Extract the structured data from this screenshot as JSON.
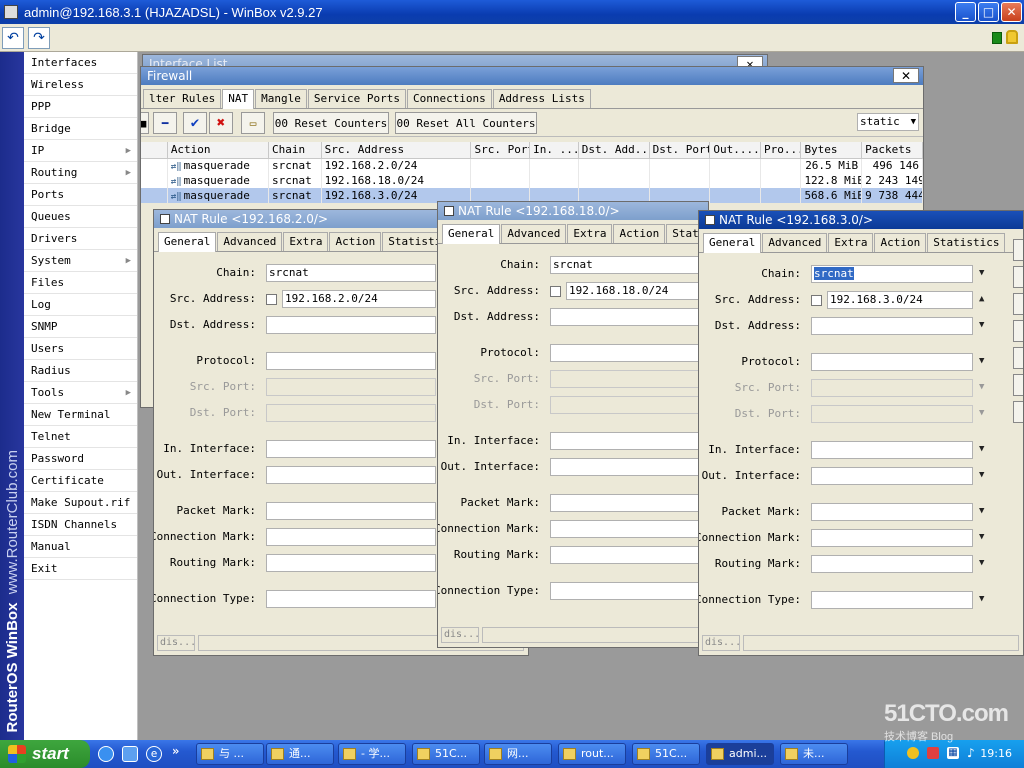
{
  "main_window": {
    "title": "admin@192.168.3.1 (HJAZADSL) - WinBox v2.9.27",
    "brand_text": "RouterOS WinBox",
    "brand_url": "www.RouterClub.com"
  },
  "left_menu": {
    "items": [
      {
        "label": "Interfaces",
        "has_submenu": false
      },
      {
        "label": "Wireless",
        "has_submenu": false
      },
      {
        "label": "PPP",
        "has_submenu": false
      },
      {
        "label": "Bridge",
        "has_submenu": false
      },
      {
        "label": "IP",
        "has_submenu": true
      },
      {
        "label": "Routing",
        "has_submenu": true
      },
      {
        "label": "Ports",
        "has_submenu": false
      },
      {
        "label": "Queues",
        "has_submenu": false
      },
      {
        "label": "Drivers",
        "has_submenu": false
      },
      {
        "label": "System",
        "has_submenu": true
      },
      {
        "label": "Files",
        "has_submenu": false
      },
      {
        "label": "Log",
        "has_submenu": false
      },
      {
        "label": "SNMP",
        "has_submenu": false
      },
      {
        "label": "Users",
        "has_submenu": false
      },
      {
        "label": "Radius",
        "has_submenu": false
      },
      {
        "label": "Tools",
        "has_submenu": true
      },
      {
        "label": "New Terminal",
        "has_submenu": false
      },
      {
        "label": "Telnet",
        "has_submenu": false
      },
      {
        "label": "Password",
        "has_submenu": false
      },
      {
        "label": "Certificate",
        "has_submenu": false
      },
      {
        "label": "Make Supout.rif",
        "has_submenu": false
      },
      {
        "label": "ISDN Channels",
        "has_submenu": false
      },
      {
        "label": "Manual",
        "has_submenu": false
      },
      {
        "label": "Exit",
        "has_submenu": false
      }
    ]
  },
  "interface_list": {
    "title": "Interface List"
  },
  "firewall": {
    "title": "Firewall",
    "tabs": [
      "lter Rules",
      "NAT",
      "Mangle",
      "Service Ports",
      "Connections",
      "Address Lists"
    ],
    "active_tab": 1,
    "reset_counters": "00 Reset Counters",
    "reset_all_counters": "00 Reset All Counters",
    "filter_value": "static",
    "columns": [
      "Action",
      "Chain",
      "Src. Address",
      "Src. Port",
      "In. ...",
      "Dst. Add...",
      "Dst. Port",
      "Out....",
      "Pro...",
      "Bytes",
      "Packets"
    ],
    "rows": [
      {
        "action": "masquerade",
        "chain": "srcnat",
        "src": "192.168.2.0/24",
        "bytes": "26.5 MiB",
        "packets": "496 146",
        "selected": false
      },
      {
        "action": "masquerade",
        "chain": "srcnat",
        "src": "192.168.18.0/24",
        "bytes": "122.8 MiB",
        "packets": "2 243 149",
        "selected": false
      },
      {
        "action": "masquerade",
        "chain": "srcnat",
        "src": "192.168.3.0/24",
        "bytes": "568.6 MiB",
        "packets": "9 738 444",
        "selected": true
      }
    ]
  },
  "nat_labels": {
    "tabs": [
      "General",
      "Advanced",
      "Extra",
      "Action",
      "Statistics"
    ],
    "chain": "Chain:",
    "src_address": "Src. Address:",
    "dst_address": "Dst. Address:",
    "protocol": "Protocol:",
    "src_port": "Src. Port:",
    "dst_port": "Dst. Port:",
    "in_interface": "In. Interface:",
    "out_interface": "Out. Interface:",
    "packet_mark": "Packet Mark:",
    "connection_mark": "Connection Mark:",
    "routing_mark": "Routing Mark:",
    "connection_type": "Connection Type:",
    "status": "dis..."
  },
  "nat_windows": [
    {
      "title": "NAT Rule <192.168.2.0/>",
      "chain": "srcnat",
      "src_address": "192.168.2.0/24"
    },
    {
      "title": "NAT Rule <192.168.18.0/>",
      "chain": "srcnat",
      "src_address": "192.168.18.0/24"
    },
    {
      "title": "NAT Rule <192.168.3.0/>",
      "chain": "srcnat",
      "src_address": "192.168.3.0/24"
    }
  ],
  "taskbar": {
    "start": "start",
    "tasks": [
      "与 ...",
      "通...",
      "- 学...",
      "51C...",
      "网...",
      "rout...",
      "51C...",
      "admi...",
      "未..."
    ],
    "active_task": 7,
    "clock": "19:16"
  },
  "watermark": {
    "logo": "51CTO.com",
    "sub": "技术博客 Blog"
  }
}
